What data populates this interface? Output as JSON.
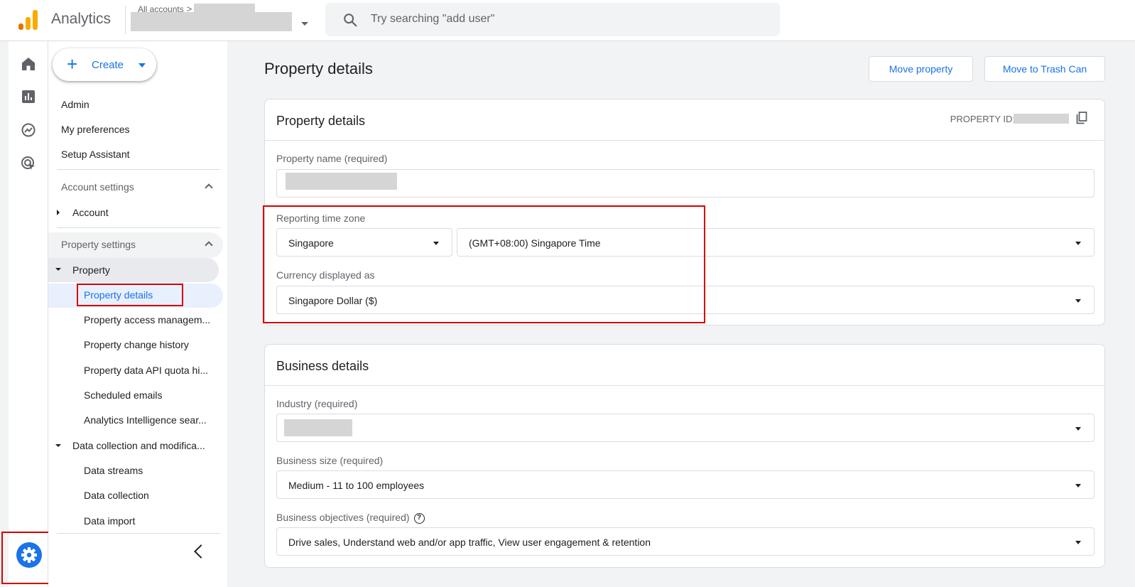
{
  "app": {
    "title": "Analytics"
  },
  "account_switcher": {
    "breadcrumb": "All accounts",
    "breadcrumb_chevron": ">"
  },
  "search": {
    "placeholder": "Try searching \"add user\""
  },
  "rail": {
    "icons": [
      "home-icon",
      "reports-icon",
      "explore-icon",
      "advertising-icon"
    ],
    "admin_icon": "gear-icon"
  },
  "sidebar": {
    "create_label": "Create",
    "top_items": [
      "Admin",
      "My preferences",
      "Setup Assistant"
    ],
    "account_settings": {
      "label": "Account settings",
      "items": [
        "Account"
      ]
    },
    "property_settings": {
      "label": "Property settings",
      "group_label": "Property",
      "items": [
        "Property details",
        "Property access managem...",
        "Property change history",
        "Property data API quota hi...",
        "Scheduled emails",
        "Analytics Intelligence sear..."
      ],
      "data_group_label": "Data collection and modifica...",
      "data_items": [
        "Data streams",
        "Data collection",
        "Data import"
      ]
    },
    "active_item": "Property details"
  },
  "page": {
    "title": "Property details",
    "move_property": "Move property",
    "move_to_trash": "Move to Trash Can"
  },
  "property_card": {
    "title": "Property details",
    "property_id_label": "PROPERTY ID:",
    "property_name_label": "Property name (required)",
    "timezone_label": "Reporting time zone",
    "timezone_country": "Singapore",
    "timezone_value": "(GMT+08:00) Singapore Time",
    "currency_label": "Currency displayed as",
    "currency_value": "Singapore Dollar ($)"
  },
  "business_card": {
    "title": "Business details",
    "industry_label": "Industry (required)",
    "size_label": "Business size (required)",
    "size_value": "Medium - 11 to 100 employees",
    "objectives_label": "Business objectives (required)",
    "objectives_value": "Drive sales, Understand web and/or app traffic, View user engagement & retention"
  },
  "colors": {
    "accent": "#1a73e8",
    "highlight": "#d50000",
    "logo_orange": "#f9ab00",
    "logo_dark": "#e37400"
  }
}
